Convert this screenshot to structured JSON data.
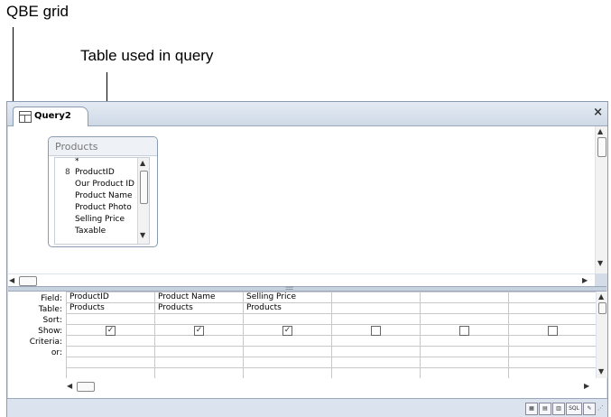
{
  "callouts": {
    "qbe_grid": "QBE grid",
    "table_used": "Table used in query"
  },
  "window": {
    "tab_title": "Query2",
    "close": "×"
  },
  "table_box": {
    "title": "Products",
    "fields": [
      "*",
      "ProductID",
      "Our Product ID",
      "Product Name",
      "Product Photo",
      "Selling Price",
      "Taxable"
    ],
    "key_icon": "8"
  },
  "grid": {
    "row_labels": [
      "Field:",
      "Table:",
      "Sort:",
      "Show:",
      "Criteria:",
      "or:"
    ],
    "columns": [
      {
        "field": "ProductID",
        "table": "Products",
        "show": true
      },
      {
        "field": "Product Name",
        "table": "Products",
        "show": true
      },
      {
        "field": "Selling Price",
        "table": "Products",
        "show": true
      },
      {
        "field": "",
        "table": "",
        "show": false
      },
      {
        "field": "",
        "table": "",
        "show": false
      },
      {
        "field": "",
        "table": "",
        "show": false
      }
    ],
    "check_mark": "✓"
  },
  "statusbar": {
    "views": [
      "datasheet-view",
      "pivottable-view",
      "pivotchart-view",
      "SQL",
      "design-view"
    ],
    "sql_label": "SQL"
  },
  "icons": {
    "up": "▲",
    "down": "▼",
    "left": "◀",
    "right": "▶",
    "grip": "::::::::"
  }
}
